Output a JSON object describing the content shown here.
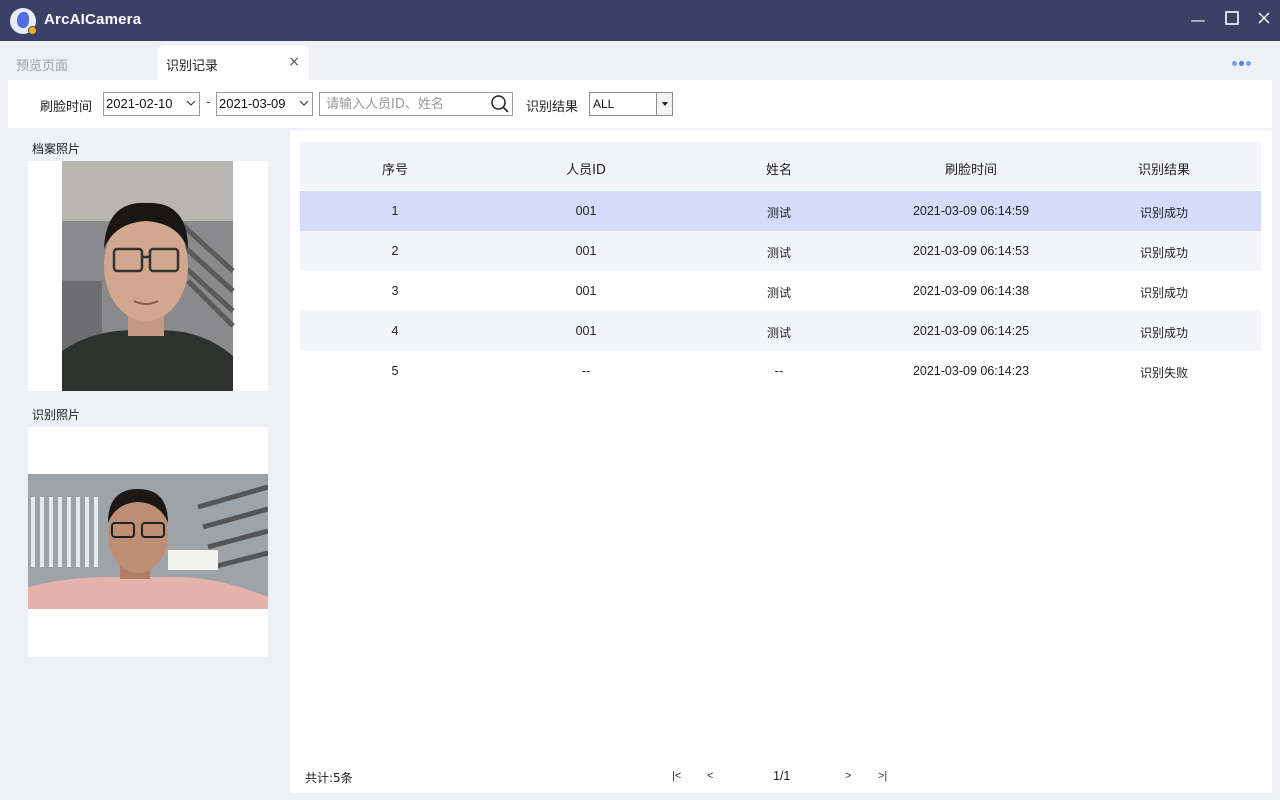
{
  "app": {
    "title": "ArcAICamera",
    "colors": {
      "titlebar": "#3a4066",
      "accent": "#4d7de8",
      "row_selected": "#d3dcfb",
      "row_alt": "#f4f5fa"
    }
  },
  "window_controls": {
    "minimize": "—",
    "maximize": "☐",
    "close": "✕"
  },
  "tabs": [
    {
      "label": "预览页面",
      "active": false
    },
    {
      "label": "识别记录",
      "active": true,
      "close": "×"
    }
  ],
  "filters": {
    "time_label": "刷脸时间",
    "date_from": "2021-02-10",
    "separator": "-",
    "date_to": "2021-03-09",
    "search_placeholder": "请输入人员ID、姓名",
    "result_label": "识别结果",
    "result_value": "ALL"
  },
  "photos": {
    "archive_label": "档案照片",
    "capture_label": "识别照片"
  },
  "table": {
    "headers": [
      "序号",
      "人员ID",
      "姓名",
      "刷脸时间",
      "识别结果"
    ],
    "rows": [
      [
        "1",
        "001",
        "测试",
        "2021-03-09 06:14:59",
        "识别成功"
      ],
      [
        "2",
        "001",
        "测试",
        "2021-03-09 06:14:53",
        "识别成功"
      ],
      [
        "3",
        "001",
        "测试",
        "2021-03-09 06:14:38",
        "识别成功"
      ],
      [
        "4",
        "001",
        "测试",
        "2021-03-09 06:14:25",
        "识别成功"
      ],
      [
        "5",
        "--",
        "--",
        "2021-03-09 06:14:23",
        "识别失败"
      ]
    ],
    "selected_row": 0
  },
  "footer": {
    "total": "共计:5条",
    "first": "|<",
    "prev": "<",
    "page": "1/1",
    "next": ">",
    "last": ">|"
  }
}
